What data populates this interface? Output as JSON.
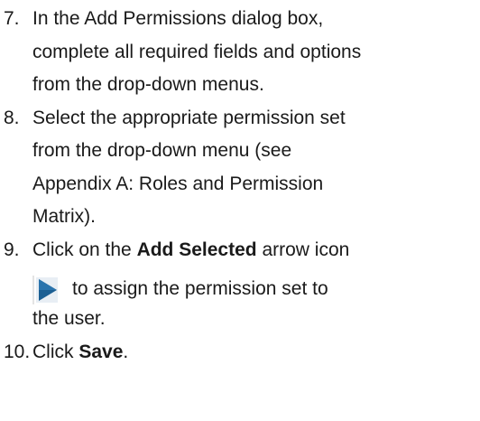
{
  "steps": [
    {
      "number": "7.",
      "lines": [
        "In the Add Permissions dialog box,",
        "complete all required fields and options",
        "from the drop-down menus."
      ]
    },
    {
      "number": "8.",
      "lines": [
        "Select the appropriate permission set",
        "from the drop-down menu (see",
        "Appendix A: Roles and Permission",
        "Matrix)."
      ]
    },
    {
      "number": "9.",
      "pre": "Click on the ",
      "bold": "Add Selected",
      "post": " arrow icon",
      "icon": "add-selected-arrow-icon",
      "after_icon": "to assign the permission set to",
      "last": "the user."
    },
    {
      "number": "10.",
      "pre": "Click ",
      "bold": "Save",
      "post": "."
    }
  ],
  "colors": {
    "icon_fill": "#1b5f93",
    "icon_bg": "#e8eef4"
  }
}
